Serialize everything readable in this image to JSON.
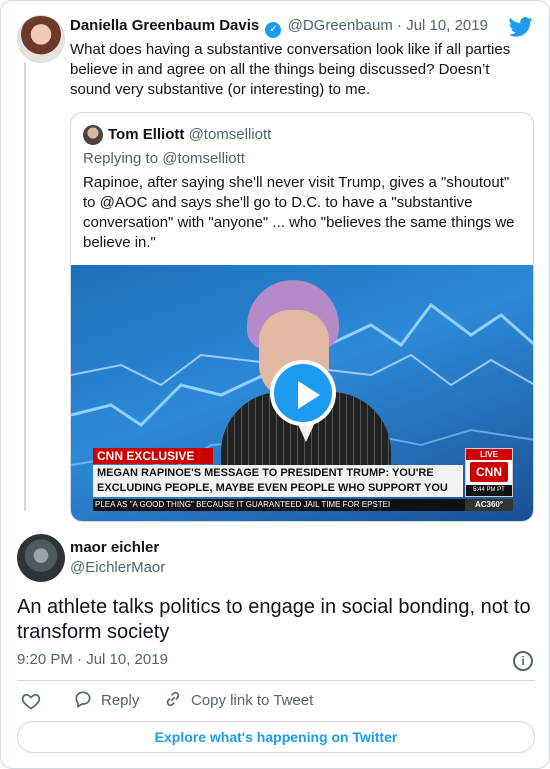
{
  "parent_tweet": {
    "name": "Daniella Greenbaum Davis",
    "handle": "@DGreenbaum",
    "separator": "·",
    "date": "Jul 10, 2019",
    "text": "What does having a substantive conversation look like if all parties believe in and agree on all the things being discussed? Doesn’t sound very substantive (or interesting) to me."
  },
  "quoted_tweet": {
    "name": "Tom Elliott",
    "handle": "@tomselliott",
    "replying_to": "Replying to @tomselliott",
    "text": "Rapinoe, after saying she'll never visit Trump, gives a \"shoutout\" to @AOC and says she'll go to D.C. to have a \"substantive conversation\" with \"anyone\" ... who \"believes the same things we believe in.\"",
    "video": {
      "cnn_exclusive": "CNN EXCLUSIVE",
      "headline": "MEGAN RAPINOE'S MESSAGE TO PRESIDENT TRUMP: YOU'RE EXCLUDING PEOPLE, MAYBE EVEN PEOPLE WHO SUPPORT YOU",
      "live": "LIVE",
      "logo": "CNN",
      "time": "5:44 PM PT",
      "ticker": "PLEA AS \"A GOOD THING\" BECAUSE IT GUARANTEED JAIL TIME FOR EPSTEI",
      "ticker_tag": "AC360°"
    }
  },
  "main_tweet": {
    "name": "maor eichler",
    "handle": "@EichlerMaor",
    "text": "An athlete talks politics to engage in social bonding, not to transform society",
    "timestamp": "9:20 PM · Jul 10, 2019",
    "info_glyph": "i"
  },
  "actions": {
    "reply": "Reply",
    "copy_link": "Copy link to Tweet"
  },
  "footer": {
    "explore": "Explore what's happening on Twitter"
  },
  "colors": {
    "accent": "#1d9bf0",
    "muted": "#536471",
    "border": "#cfd9de",
    "cnn_red": "#cc0000"
  },
  "icons": {
    "verified": "verified-badge-icon",
    "bird": "twitter-bird-icon",
    "heart": "heart-icon",
    "reply": "reply-bubble-icon",
    "link": "link-icon",
    "info": "info-icon",
    "play": "play-icon"
  }
}
